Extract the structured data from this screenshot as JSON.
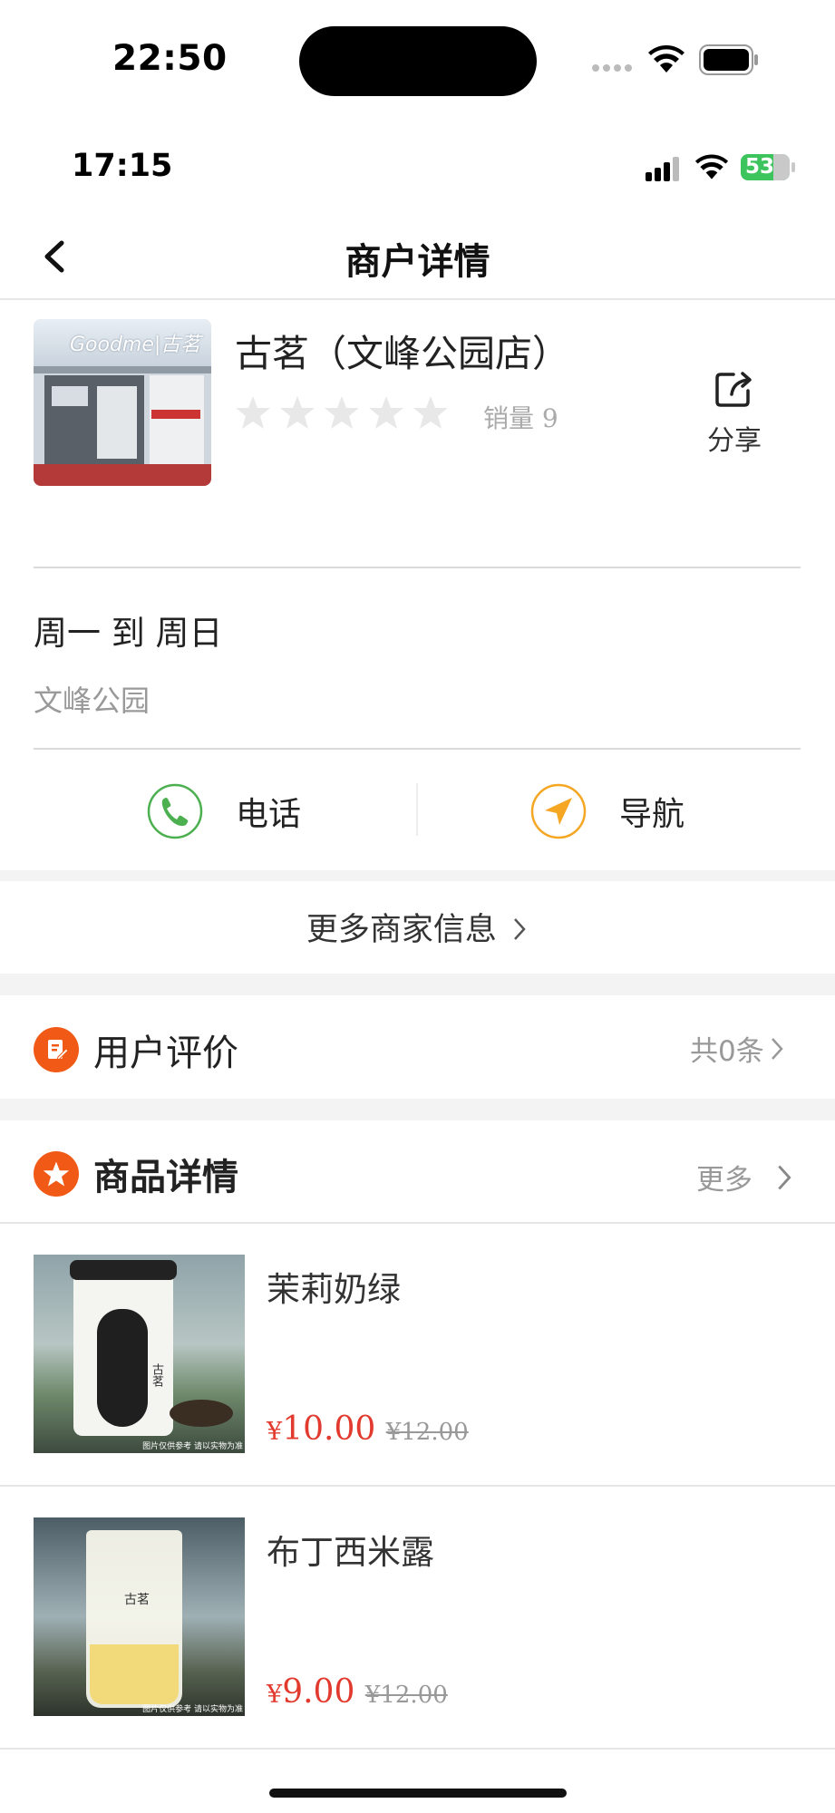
{
  "status_bar": {
    "time": "22:50"
  },
  "inner_status_bar": {
    "time": "17:15",
    "battery": "53"
  },
  "navbar": {
    "title": "商户详情"
  },
  "store": {
    "sign_text": "Goodme|古茗",
    "name": "古茗（文峰公园店）",
    "rating": 0,
    "sales_label": "销量 9",
    "share_label": "分享"
  },
  "hours": "周一 到 周日",
  "address": "文峰公园",
  "actions": {
    "phone_label": "电话",
    "nav_label": "导航"
  },
  "more_info_label": "更多商家信息",
  "reviews": {
    "title": "用户评价",
    "count_label": "共0条"
  },
  "products_section": {
    "title": "商品详情",
    "more_label": "更多"
  },
  "products": [
    {
      "name": "茉莉奶绿",
      "price": "10.00",
      "original_price": "¥12.00",
      "cup_label": "古茗",
      "note": "图片仅供参考 请以实物为准"
    },
    {
      "name": "布丁西米露",
      "price": "9.00",
      "original_price": "¥12.00",
      "cup_label": "古茗",
      "note": "图片仅供参考 请以实物为准"
    }
  ],
  "colors": {
    "accent": "#f15a16",
    "price": "#e23a2e",
    "phone_green": "#4caf50",
    "nav_orange": "#f5a623"
  }
}
